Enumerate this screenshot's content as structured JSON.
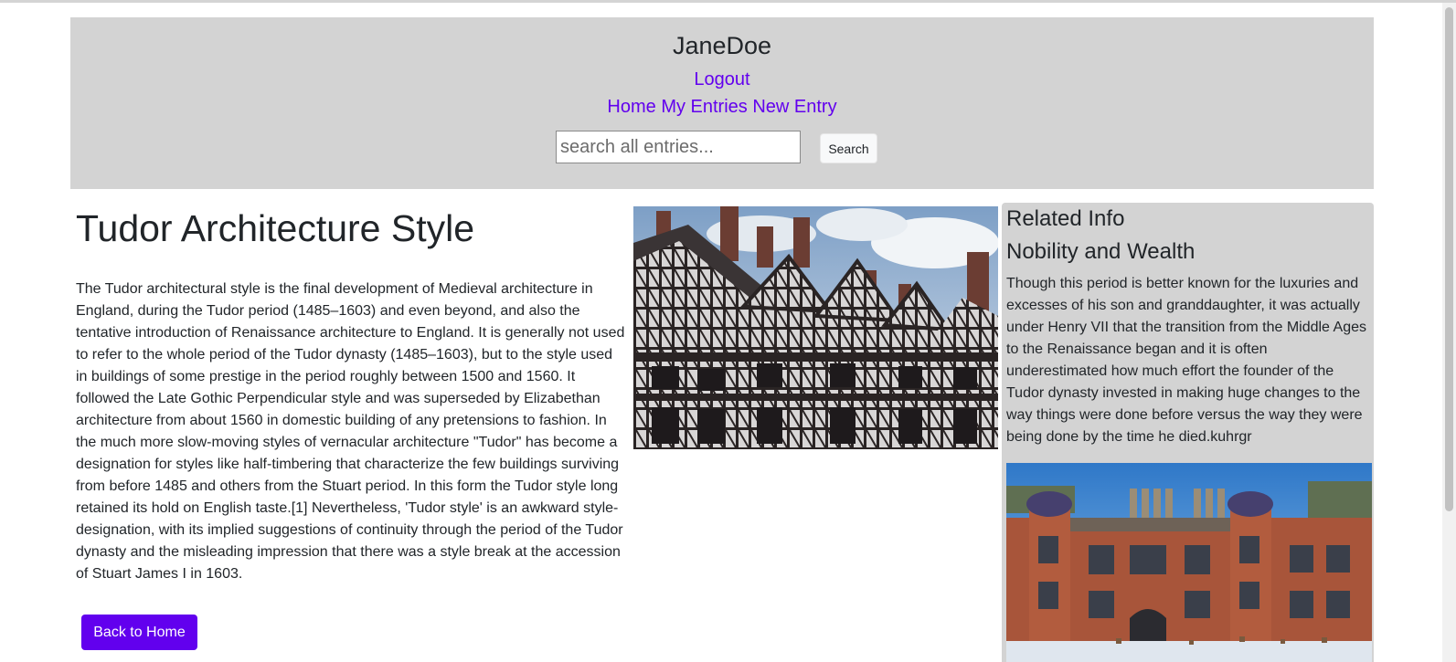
{
  "header": {
    "user_name": "JaneDoe",
    "logout_label": "Logout",
    "nav": {
      "home": "Home",
      "my_entries": "My Entries",
      "new_entry": "New Entry"
    },
    "search": {
      "placeholder": "search all entries...",
      "value": "",
      "button_label": "Search"
    }
  },
  "entry": {
    "title": "Tudor Architecture Style",
    "body": "The Tudor architectural style is the final development of Medieval architecture in England, during the Tudor period (1485–1603) and even beyond, and also the tentative introduction of Renaissance architecture to England. It is generally not used to refer to the whole period of the Tudor dynasty (1485–1603), but to the style used in buildings of some prestige in the period roughly between 1500 and 1560. It followed the Late Gothic Perpendicular style and was superseded by Elizabethan architecture from about 1560 in domestic building of any pretensions to fashion. In the much more slow-moving styles of vernacular architecture \"Tudor\" has become a designation for styles like half-timbering that characterize the few buildings surviving from before 1485 and others from the Stuart period. In this form the Tudor style long retained its hold on English taste.[1] Nevertheless, 'Tudor style' is an awkward style-designation, with its implied suggestions of continuity through the period of the Tudor dynasty and the misleading impression that there was a style break at the accession of Stuart James I in 1603.",
    "back_label": "Back to Home"
  },
  "related": {
    "heading": "Related Info",
    "subtitle": "Nobility and Wealth",
    "text": "Though this period is better known for the luxuries and excesses of his son and granddaughter, it was actually under Henry VII that the transition from the Middle Ages to the Renaissance began and it is often underestimated how much effort the founder of the Tudor dynasty invested in making huge changes to the way things were done before versus the way they were being done by the time he died.kuhrgr"
  },
  "colors": {
    "accent": "#6200ee",
    "panel_background": "#d3d3d3",
    "text": "#212529"
  }
}
